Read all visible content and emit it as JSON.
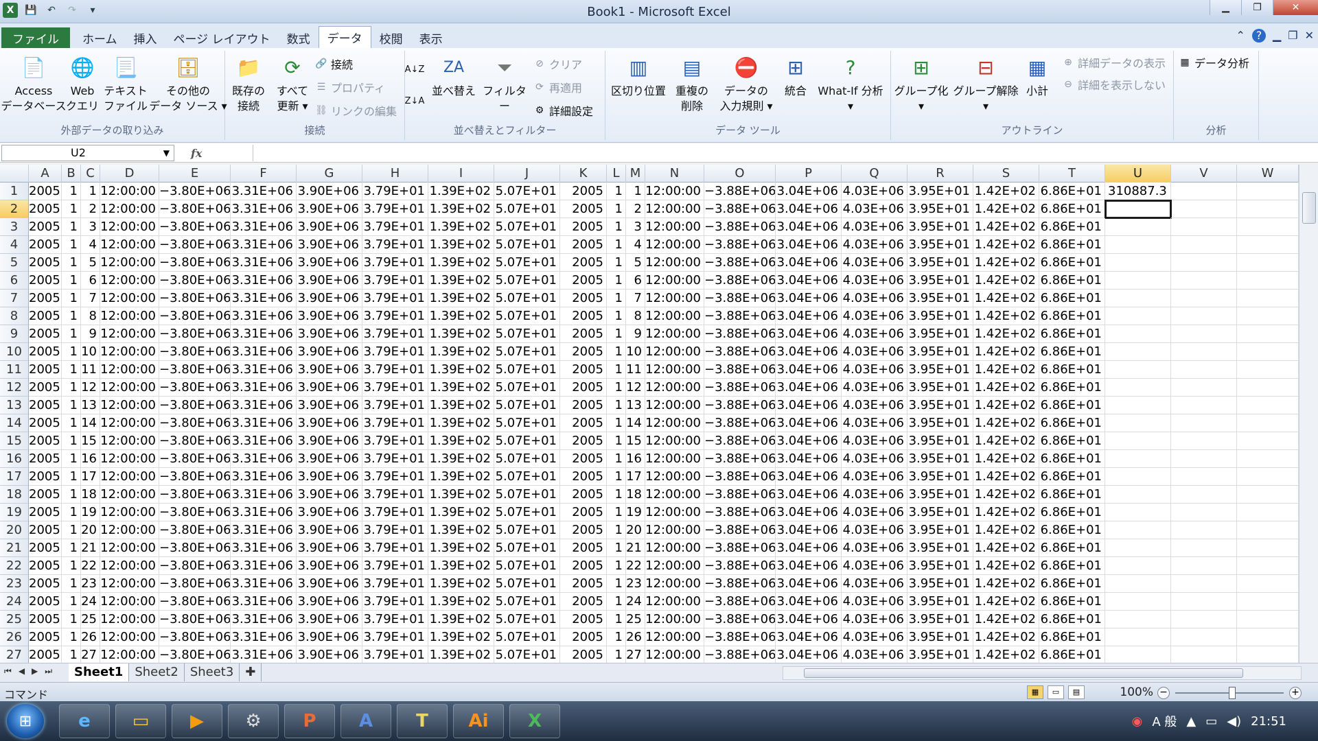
{
  "window": {
    "title": "Book1 - Microsoft Excel"
  },
  "ribbon_tabs": [
    "ファイル",
    "ホーム",
    "挿入",
    "ページ レイアウト",
    "数式",
    "データ",
    "校閲",
    "表示"
  ],
  "groups": {
    "external": {
      "label": "外部データの取り込み",
      "access": "Access\nデータベース",
      "web": "Web\nクエリ",
      "text": "テキスト\nファイル",
      "other": "その他の\nデータ ソース ▾"
    },
    "connect": {
      "label": "接続",
      "existing": "既存の\n接続",
      "refresh": "すべて\n更新 ▾",
      "connections": "接続",
      "properties": "プロパティ",
      "edit_links": "リンクの編集"
    },
    "sortfilter": {
      "label": "並べ替えとフィルター",
      "sort": "並べ替え",
      "filter": "フィルター",
      "clear": "クリア",
      "reapply": "再適用",
      "advanced": "詳細設定"
    },
    "datatools": {
      "label": "データ ツール",
      "text_to_col": "区切り位置",
      "remove_dup": "重複の\n削除",
      "validation": "データの\n入力規則 ▾",
      "consolidate": "統合",
      "whatif": "What-If 分析\n▾"
    },
    "outline": {
      "label": "アウトライン",
      "group": "グループ化\n▾",
      "ungroup": "グループ解除\n▾",
      "subtotal": "小計",
      "show_detail": "詳細データの表示",
      "hide_detail": "詳細を表示しない"
    },
    "analysis": {
      "label": "分析",
      "data_analysis": "データ分析"
    }
  },
  "formula_bar": {
    "name_box": "U2",
    "fx": "fx",
    "formula": ""
  },
  "columns": [
    "A",
    "B",
    "C",
    "D",
    "E",
    "F",
    "G",
    "H",
    "I",
    "J",
    "K",
    "L",
    "M",
    "N",
    "O",
    "P",
    "Q",
    "R",
    "S",
    "T",
    "U",
    "V",
    "W"
  ],
  "row_template": {
    "A": "2005",
    "B": "1",
    "D": "12:00:00",
    "E": "−3.80E+06",
    "F": "3.31E+06",
    "G": "3.90E+06",
    "H": "3.79E+01",
    "I": "1.39E+02",
    "J": "5.07E+01",
    "K": "2005",
    "L": "1",
    "N": "12:00:00",
    "O": "−3.88E+06",
    "P": "3.04E+06",
    "Q": "4.03E+06",
    "R": "3.95E+01",
    "S": "1.42E+02",
    "T": "6.86E+01"
  },
  "row1_T": "6.86E+01",
  "cell_U1": "310887.3",
  "row_count": 27,
  "active_cell": "U2",
  "sheets": [
    "Sheet1",
    "Sheet2",
    "Sheet3"
  ],
  "status": {
    "mode": "コマンド",
    "zoom": "100%"
  },
  "taskbar": {
    "time": "21:51",
    "ime": "A 般"
  }
}
